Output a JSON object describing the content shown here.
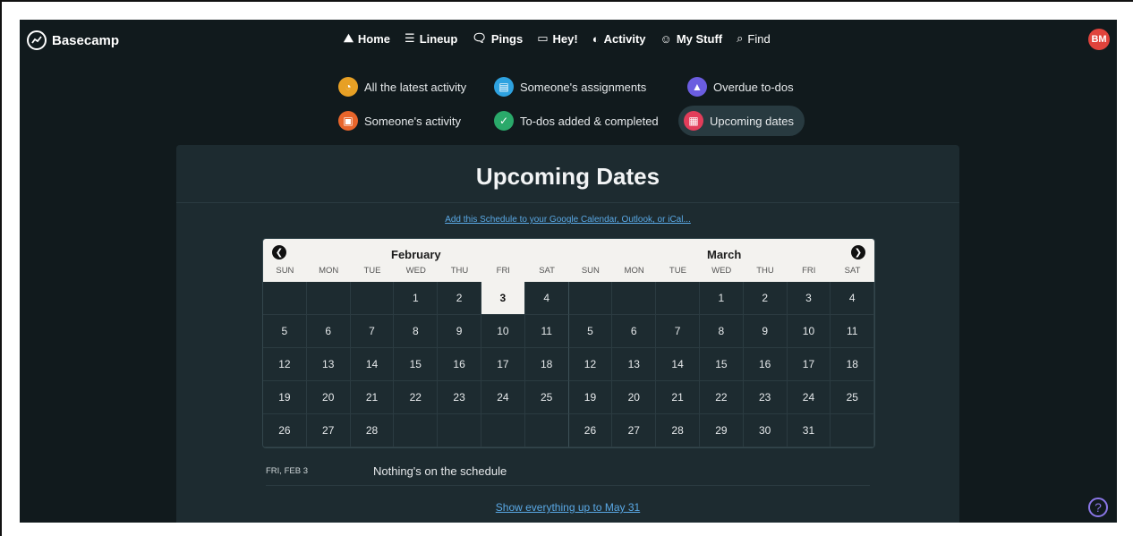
{
  "app": {
    "name": "Basecamp",
    "avatar_initials": "BM"
  },
  "nav": [
    {
      "label": "Home",
      "icon": "mountain-icon",
      "glyph": "⛰"
    },
    {
      "label": "Lineup",
      "icon": "lineup-icon",
      "glyph": "☰"
    },
    {
      "label": "Pings",
      "icon": "pings-icon",
      "glyph": "🗨"
    },
    {
      "label": "Hey!",
      "icon": "inbox-icon",
      "glyph": "▭"
    },
    {
      "label": "Activity",
      "icon": "activity-icon",
      "glyph": "◐"
    },
    {
      "label": "My Stuff",
      "icon": "smiley-icon",
      "glyph": "☺"
    },
    {
      "label": "Find",
      "icon": "search-icon",
      "glyph": "⌕"
    }
  ],
  "filters": [
    {
      "label": "All the latest activity",
      "color": "#e7a025",
      "glyph": "◔",
      "active": false
    },
    {
      "label": "Someone's assignments",
      "color": "#2ea2e0",
      "glyph": "▤",
      "active": false
    },
    {
      "label": "Overdue to-dos",
      "color": "#6b5de0",
      "glyph": "▲",
      "active": false
    },
    {
      "label": "Someone's activity",
      "color": "#e8652b",
      "glyph": "▣",
      "active": false
    },
    {
      "label": "To-dos added & completed",
      "color": "#2aa96a",
      "glyph": "✓",
      "active": false
    },
    {
      "label": "Upcoming dates",
      "color": "#e23d5a",
      "glyph": "▦",
      "active": true
    }
  ],
  "panel": {
    "title": "Upcoming Dates",
    "calendar_link": "Add this Schedule to your Google Calendar, Outlook, or iCal...",
    "more_link": "Show everything up to May 31"
  },
  "calendar": {
    "months": [
      "February",
      "March"
    ],
    "weekdays": [
      "SUN",
      "MON",
      "TUE",
      "WED",
      "THU",
      "FRI",
      "SAT",
      "SUN",
      "MON",
      "TUE",
      "WED",
      "THU",
      "FRI",
      "SAT"
    ],
    "rows": [
      [
        null,
        null,
        null,
        1,
        2,
        3,
        4,
        null,
        null,
        null,
        1,
        2,
        3,
        4
      ],
      [
        5,
        6,
        7,
        8,
        9,
        10,
        11,
        5,
        6,
        7,
        8,
        9,
        10,
        11
      ],
      [
        12,
        13,
        14,
        15,
        16,
        17,
        18,
        12,
        13,
        14,
        15,
        16,
        17,
        18
      ],
      [
        19,
        20,
        21,
        22,
        23,
        24,
        25,
        19,
        20,
        21,
        22,
        23,
        24,
        25
      ],
      [
        26,
        27,
        28,
        null,
        null,
        null,
        null,
        26,
        27,
        28,
        29,
        30,
        31,
        null
      ]
    ],
    "today": {
      "month_index": 0,
      "day": 3
    }
  },
  "schedule": {
    "date": "FRI, FEB 3",
    "message": "Nothing's on the schedule"
  },
  "help_label": "?"
}
